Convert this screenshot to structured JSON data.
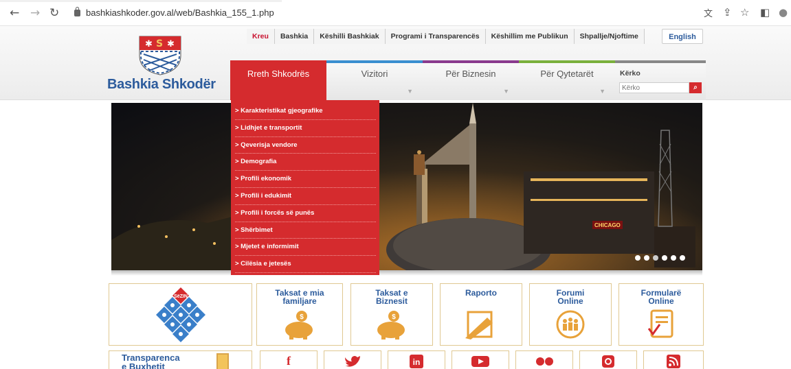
{
  "browser": {
    "url": "bashkiashkoder.gov.al/web/Bashkia_155_1.php"
  },
  "logo": {
    "text": "Bashkia Shkodër"
  },
  "top_links": [
    "Kreu",
    "Bashkia",
    "Këshilli Bashkiak",
    "Programi i Transparencës",
    "Këshillim me Publikun",
    "Shpallje/Njoftime"
  ],
  "language_button": "English",
  "main_nav": [
    {
      "label": "Rreth Shkodrës",
      "color": "#d52b2e"
    },
    {
      "label": "Vizitori",
      "color": "#3a8fd0"
    },
    {
      "label": "Për Biznesin",
      "color": "#8a3a8e"
    },
    {
      "label": "Për Qytetarët",
      "color": "#7ab03c"
    }
  ],
  "search": {
    "label": "Kërko",
    "placeholder": "Kërko"
  },
  "dropdown_items": [
    "> Karakteristikat gjeografike",
    "> Lidhjet e transportit",
    "> Qeverisja vendore",
    "> Demografia",
    "> Profili ekonomik",
    "> Profili i edukimit",
    "> Profili i forcës së punës",
    "> Shërbimet",
    "> Mjetet e informimit",
    "> Cilësia e jetesës"
  ],
  "banner": {
    "sign_text": "CHICAGO",
    "slides": 6,
    "active_slide": 2
  },
  "services": [
    {
      "line1": "Taksat e mia",
      "line2": "familjare"
    },
    {
      "line1": "Taksat e",
      "line2": "Biznesit"
    },
    {
      "line1": "Raporto",
      "line2": ""
    },
    {
      "line1": "Forumi",
      "line2": "Online"
    },
    {
      "line1": "Formularë",
      "line2": "Online"
    }
  ],
  "szin_label": "SëZIN",
  "transparency": {
    "line1": "Transparenca",
    "line2": "e Buxhetit"
  },
  "social_icons": [
    "facebook-icon",
    "twitter-icon",
    "linkedin-icon",
    "youtube-icon",
    "flickr-icon",
    "instagram-icon",
    "rss-icon"
  ],
  "colors": {
    "brand_red": "#d52b2e",
    "brand_blue": "#2c5b9c",
    "gold_border": "#e0c891"
  }
}
